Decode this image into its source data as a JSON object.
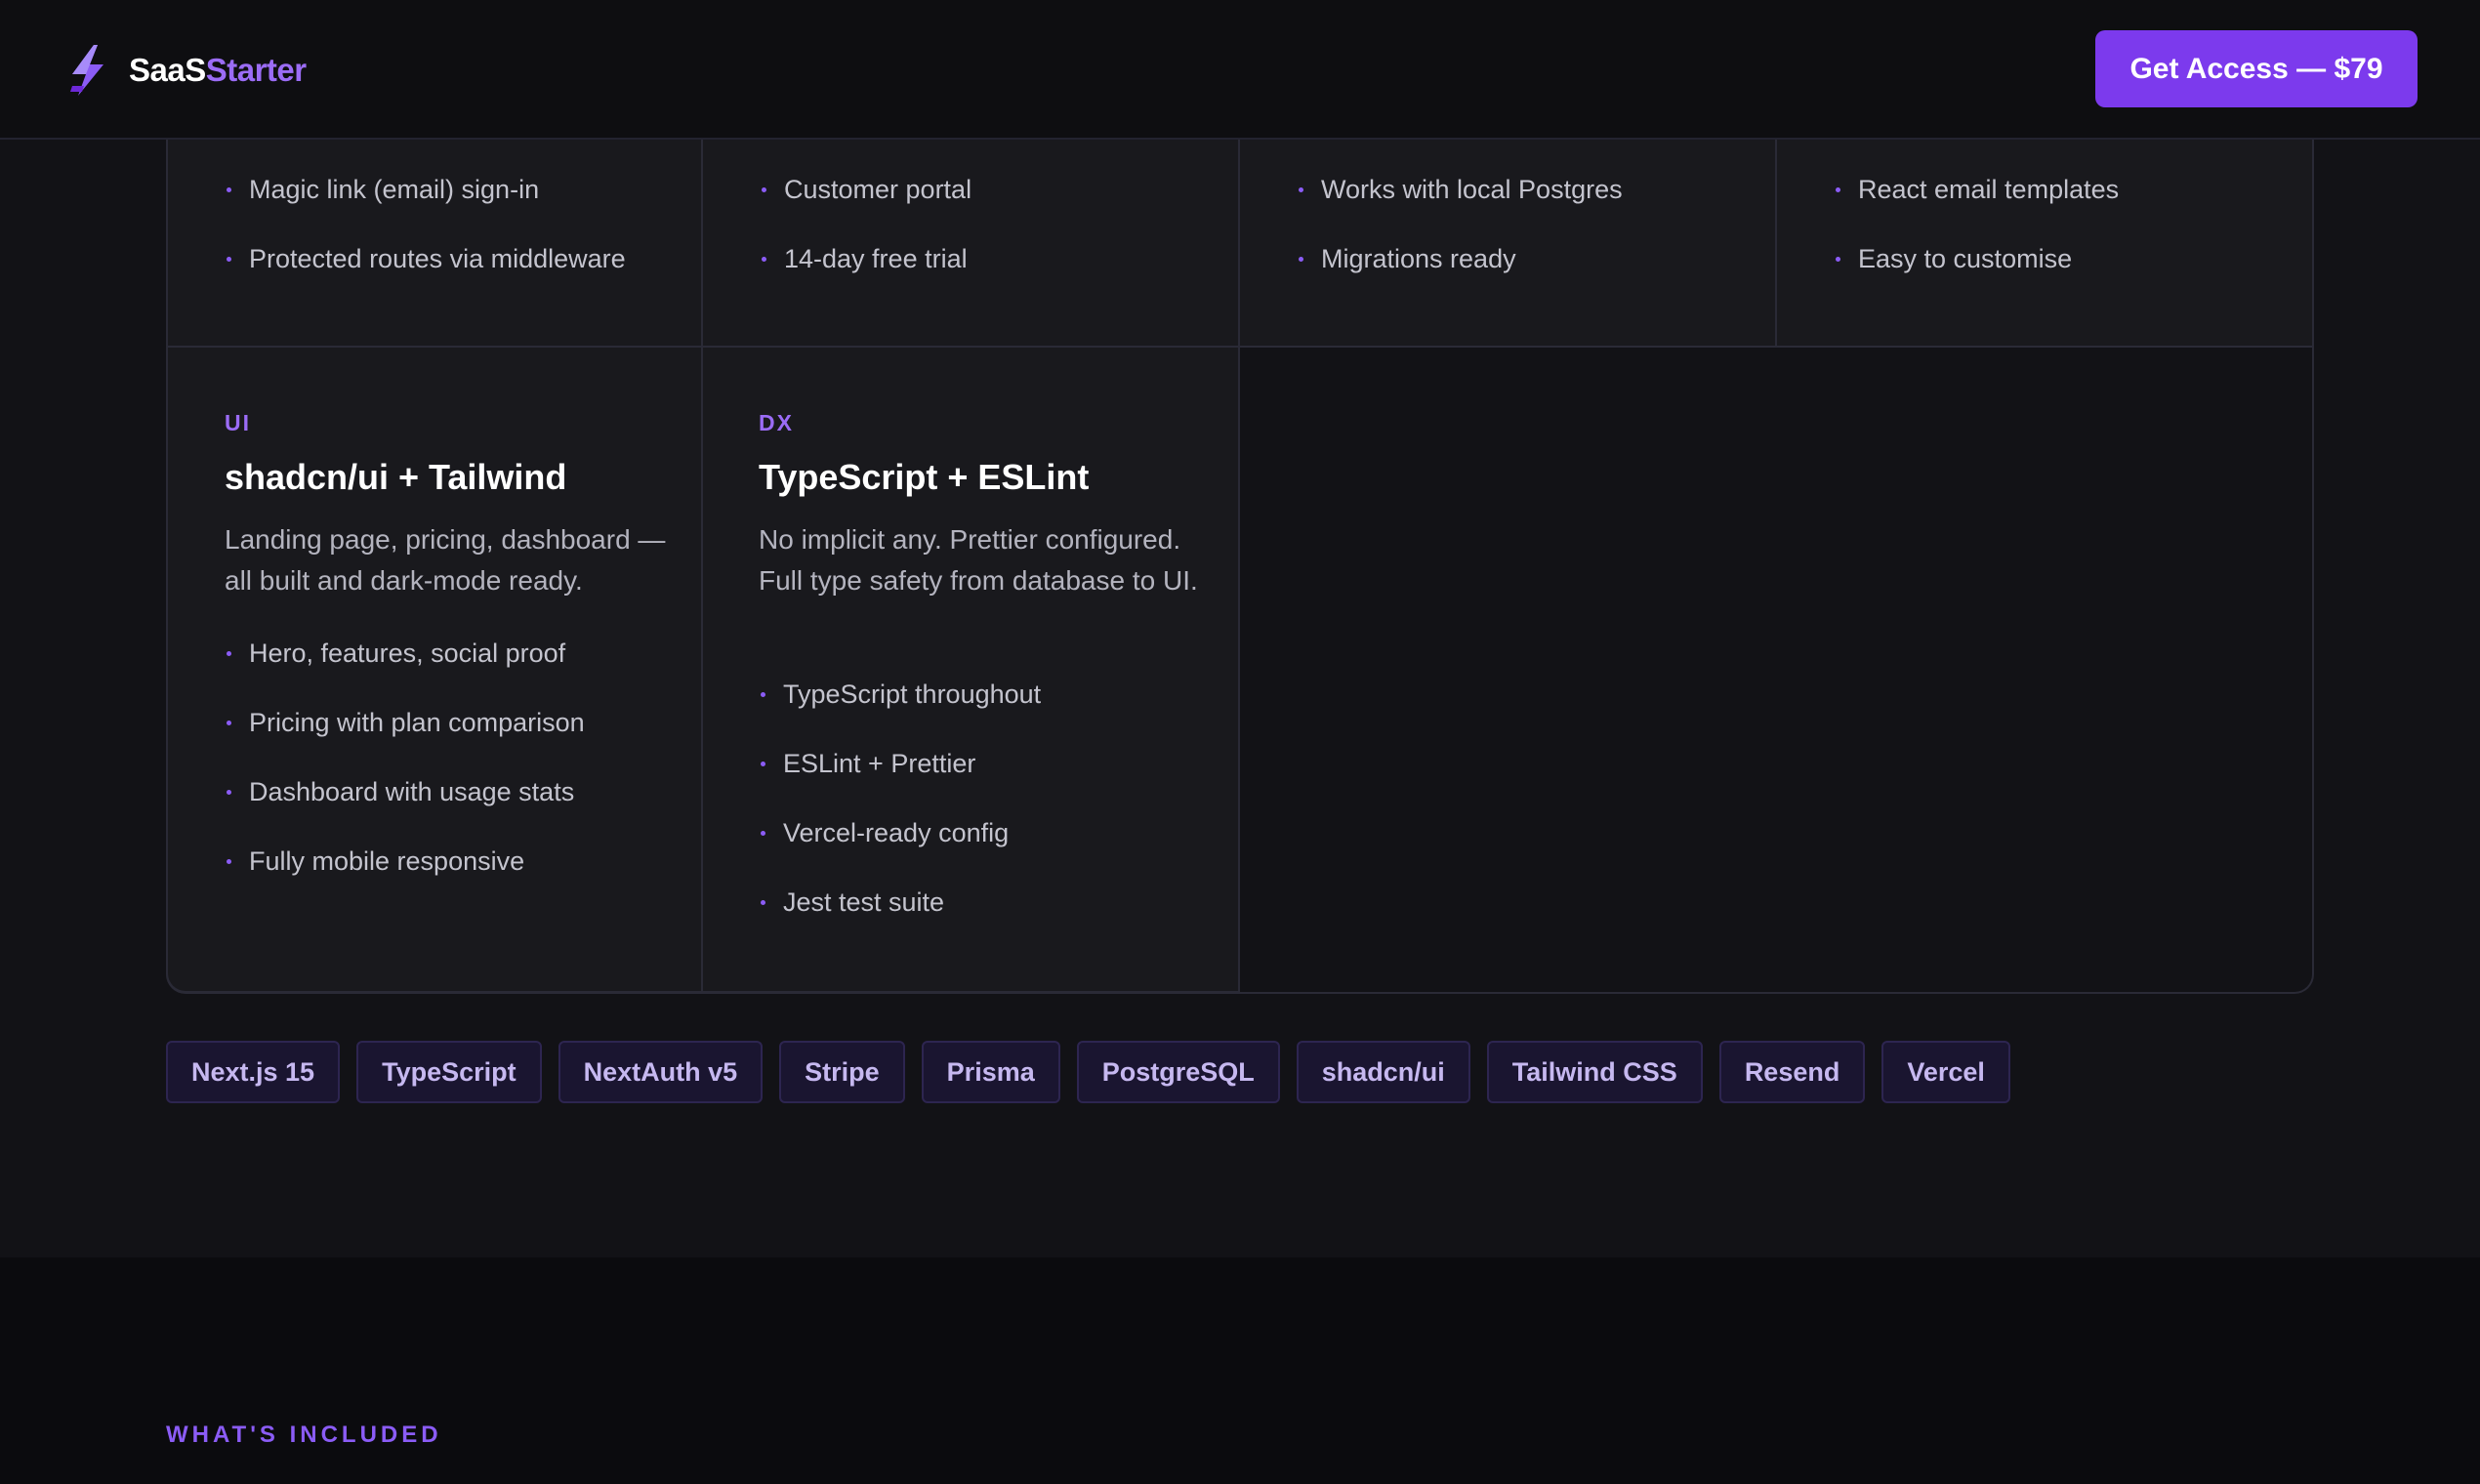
{
  "header": {
    "logo_part1": "SaaS",
    "logo_part2": "Starter",
    "logo_icon": "lightning-bolt-icon",
    "cta_label": "Get Access — $79"
  },
  "features_top": [
    {
      "bullets": [
        "Magic link (email) sign-in",
        "Protected routes via middleware"
      ]
    },
    {
      "bullets": [
        "Customer portal",
        "14-day free trial"
      ]
    },
    {
      "bullets": [
        "Works with local Postgres",
        "Migrations ready"
      ]
    },
    {
      "bullets": [
        "React email templates",
        "Easy to customise"
      ]
    }
  ],
  "features_bottom": [
    {
      "category": "UI",
      "title": "shadcn/ui + Tailwind",
      "description": "Landing page, pricing, dashboard — all built and dark-mode ready.",
      "bullets": [
        "Hero, features, social proof",
        "Pricing with plan comparison",
        "Dashboard with usage stats",
        "Fully mobile responsive"
      ]
    },
    {
      "category": "DX",
      "title": "TypeScript + ESLint",
      "description": "No implicit any. Prettier configured. Full type safety from database to UI.",
      "bullets": [
        "TypeScript throughout",
        "ESLint + Prettier",
        "Vercel-ready config",
        "Jest test suite"
      ]
    }
  ],
  "tech_tags": [
    "Next.js 15",
    "TypeScript",
    "NextAuth v5",
    "Stripe",
    "Prisma",
    "PostgreSQL",
    "shadcn/ui",
    "Tailwind CSS",
    "Resend",
    "Vercel"
  ],
  "next_section": {
    "eyebrow": "WHAT'S INCLUDED"
  },
  "colors": {
    "accent": "#7c3aed",
    "accent_text": "#9b6cf6",
    "background": "#121216",
    "card": "#19191d"
  }
}
